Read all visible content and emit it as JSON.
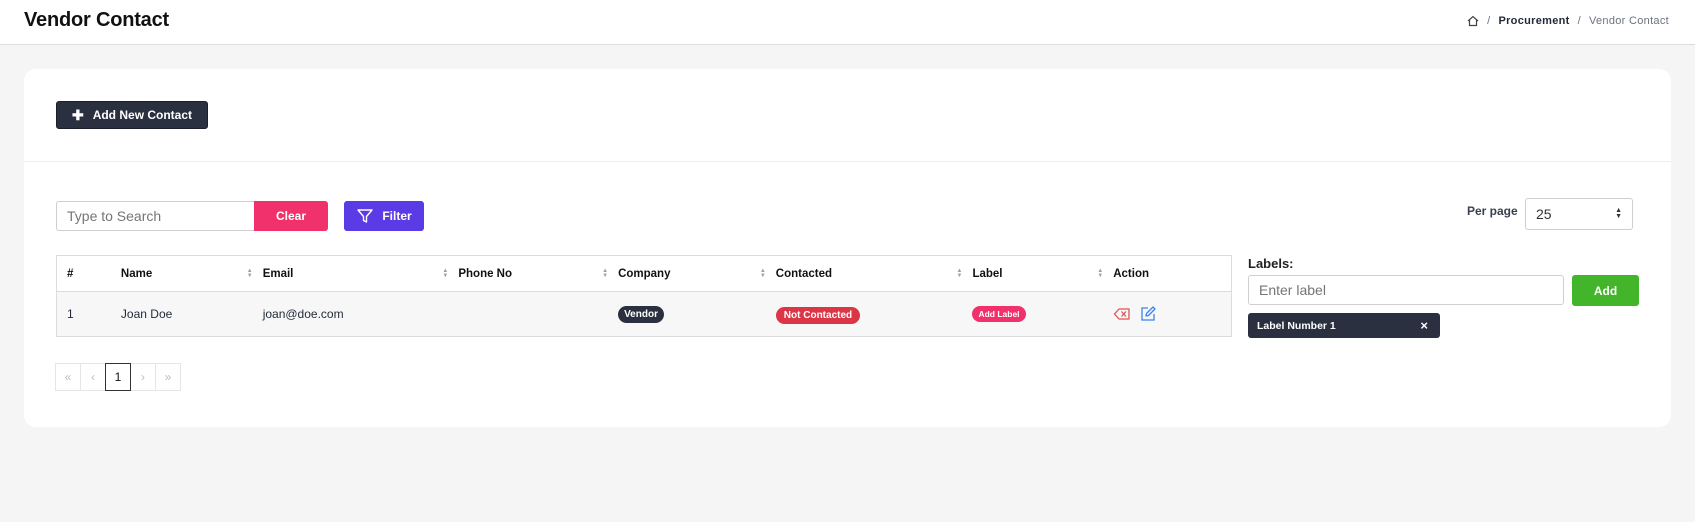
{
  "header": {
    "title": "Vendor Contact",
    "breadcrumb": {
      "sep": "/",
      "parent": "Procurement",
      "current": "Vendor Contact"
    }
  },
  "toolbar": {
    "add_contact_label": "Add New Contact",
    "search_placeholder": "Type to Search",
    "search_value": "",
    "clear_label": "Clear",
    "filter_label": "Filter",
    "per_page_label": "Per page",
    "per_page_value": "25"
  },
  "table": {
    "columns": [
      "#",
      "Name",
      "Email",
      "Phone No",
      "Company",
      "Contacted",
      "Label",
      "Action"
    ],
    "rows": [
      {
        "index": "1",
        "name": "Joan Doe",
        "email": "joan@doe.com",
        "phone": "",
        "company": "Vendor",
        "contacted": "Not Contacted",
        "label": "Add Label"
      }
    ]
  },
  "pagination": {
    "first": "«",
    "prev": "‹",
    "current": "1",
    "next": "›",
    "last": "»"
  },
  "labels_panel": {
    "title": "Labels:",
    "input_placeholder": "Enter label",
    "input_value": "",
    "add_label": "Add",
    "chips": [
      {
        "text": "Label Number 1",
        "close": "×"
      }
    ]
  },
  "colors": {
    "dark": "#2b3040",
    "pink": "#f0316b",
    "purple": "#5b3be6",
    "red": "#dc3545",
    "green": "#43b52b",
    "edit_blue": "#3b82f6"
  },
  "icons": [
    "home-icon",
    "plus-icon",
    "filter-icon",
    "sort-icon",
    "delete-icon",
    "edit-icon",
    "close-icon",
    "select-arrows-icon"
  ]
}
